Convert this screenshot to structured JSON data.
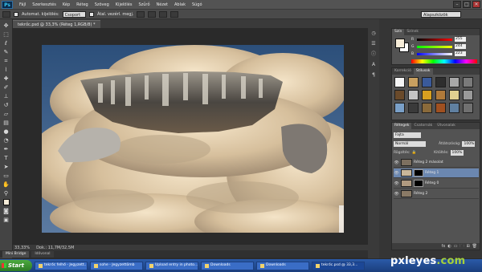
{
  "app": {
    "logo": "Ps",
    "menu": [
      "Fájl",
      "Szerkesztés",
      "Kép",
      "Réteg",
      "Szöveg",
      "Kijelölés",
      "Szűrő",
      "Nézet",
      "Ablak",
      "Súgó"
    ],
    "window_controls": [
      "–",
      "□",
      "✕"
    ]
  },
  "options_bar": {
    "auto_select_label": "Automat. kijelölés:",
    "auto_select_value": "Csoport",
    "show_transform_label": "Átal. vezérl. megj.",
    "workspace": "Alapszközök"
  },
  "document": {
    "tab_title": "tekrőc.psd @ 33,3% (Réteg 1,RGB/8) *"
  },
  "status": {
    "zoom": "33,33%",
    "doc_size": "Dok.: 11,7M/32,5M"
  },
  "bottom_tabs": [
    "Mini Bridge",
    "Idővonal"
  ],
  "color_panel": {
    "tabs": [
      "Szín",
      "Színek"
    ],
    "channels": [
      {
        "label": "R",
        "value": "255",
        "gradient": "linear-gradient(90deg,#000,#f00)"
      },
      {
        "label": "G",
        "value": "244",
        "gradient": "linear-gradient(90deg,#0f0,#ff0)"
      },
      {
        "label": "B",
        "value": "223",
        "gradient": "linear-gradient(90deg,#00f,#fff)"
      }
    ],
    "foreground_color": "#f6ecd8"
  },
  "styles_panel": {
    "tabs": [
      "Korrekció",
      "Stílusok"
    ],
    "swatches": [
      "#f5f5f5",
      "#c8a060",
      "#3a5a9a",
      "#2e2e2e",
      "#a8a8a8",
      "#7a7a7a",
      "#6a4a2a",
      "#c4c4c4",
      "#d8a020",
      "#b07a3a",
      "#e0d090",
      "#9a9a9a",
      "#7aa0c8",
      "#3a3a3a",
      "#8a6a3a",
      "#a05020",
      "#6080a0",
      "#707070"
    ]
  },
  "layers_panel": {
    "tabs": [
      "Rétegek",
      "Csatornák",
      "Útvonalak"
    ],
    "kind_label": "Fajta",
    "blend_mode": "Normál",
    "opacity_label": "Átlátszóság:",
    "opacity_value": "100%",
    "lock_label": "Rögzítés:",
    "fill_label": "Kitöltés:",
    "fill_value": "100%",
    "layers": [
      {
        "name": "Réteg 2 másolat",
        "thumb": "#7d7060",
        "mask": false,
        "selected": false
      },
      {
        "name": "Réteg 1",
        "thumb": "#c9b79a",
        "mask": true,
        "selected": true
      },
      {
        "name": "Réteg 0",
        "thumb": "#b09a80",
        "mask": true,
        "selected": false
      },
      {
        "name": "Réteg 2",
        "thumb": "#8a7a66",
        "mask": false,
        "selected": false
      }
    ],
    "footer_icons": [
      "fx",
      "◐",
      "▭",
      "🗀",
      "⊞",
      "🗑"
    ]
  },
  "taskbar": {
    "start": "Start",
    "items": [
      "tekrőc felhő - Jegyzett...",
      "sohe - Jegyzettömb",
      "Upload entry in photo...",
      "Downloads",
      "Downloads",
      "tekrőc.psd @ 33,3..."
    ],
    "active_index": 5
  },
  "watermark": {
    "main": "pxleyes",
    "suffix": ".com"
  }
}
